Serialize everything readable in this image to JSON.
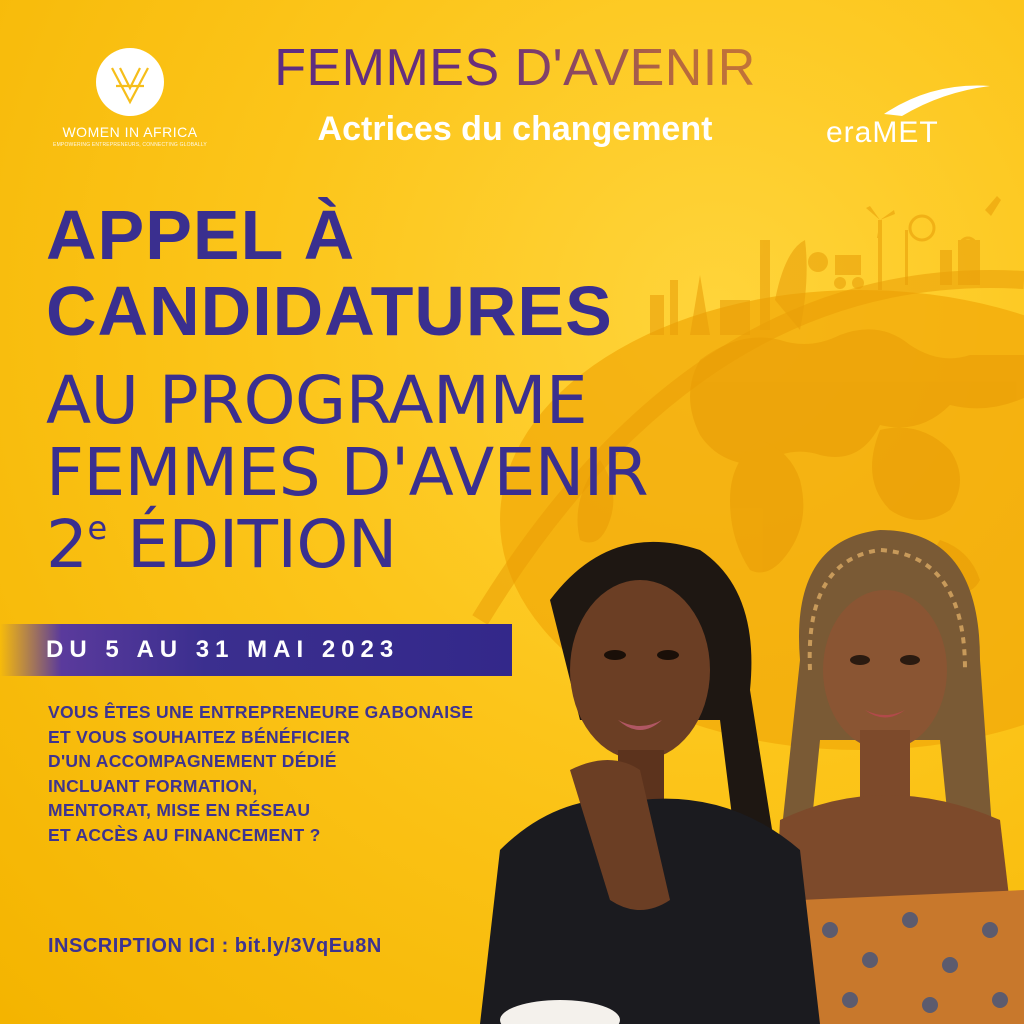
{
  "header": {
    "partner_logo_left": {
      "name": "WOMEN IN AFRICA",
      "tagline": "EMPOWERING ENTREPRENEURS, CONNECTING GLOBALLY"
    },
    "title": "FEMMES D'AVENIR",
    "subtitle": "Actrices du changement",
    "partner_logo_right": {
      "name": "eraMET"
    }
  },
  "headline": {
    "line1": "APPEL À",
    "line2": "CANDIDATURES",
    "line3": "AU PROGRAMME",
    "line4": "FEMMES D'AVENIR",
    "line5_number": "2",
    "line5_sup": "e",
    "line5_text": " ÉDITION"
  },
  "dates": "DU 5 AU 31 MAI 2023",
  "body": {
    "lines": [
      "VOUS ÊTES UNE ENTREPRENEURE GABONAISE",
      "ET VOUS SOUHAITEZ BÉNÉFICIER",
      "D'UN ACCOMPAGNEMENT DÉDIÉ",
      "INCLUANT FORMATION,",
      "MENTORAT, MISE EN RÉSEAU",
      "ET ACCÈS AU FINANCEMENT ?"
    ]
  },
  "inscription": "INSCRIPTION ICI : bit.ly/3VqEu8N",
  "colors": {
    "background": "#fcc51a",
    "headline": "#3a2f8f",
    "banner": "#33288a",
    "white": "#ffffff"
  },
  "icons": [
    "women-in-africa-logo-icon",
    "eramet-swoosh-icon",
    "globe-icon",
    "industry-silhouette-icon"
  ]
}
